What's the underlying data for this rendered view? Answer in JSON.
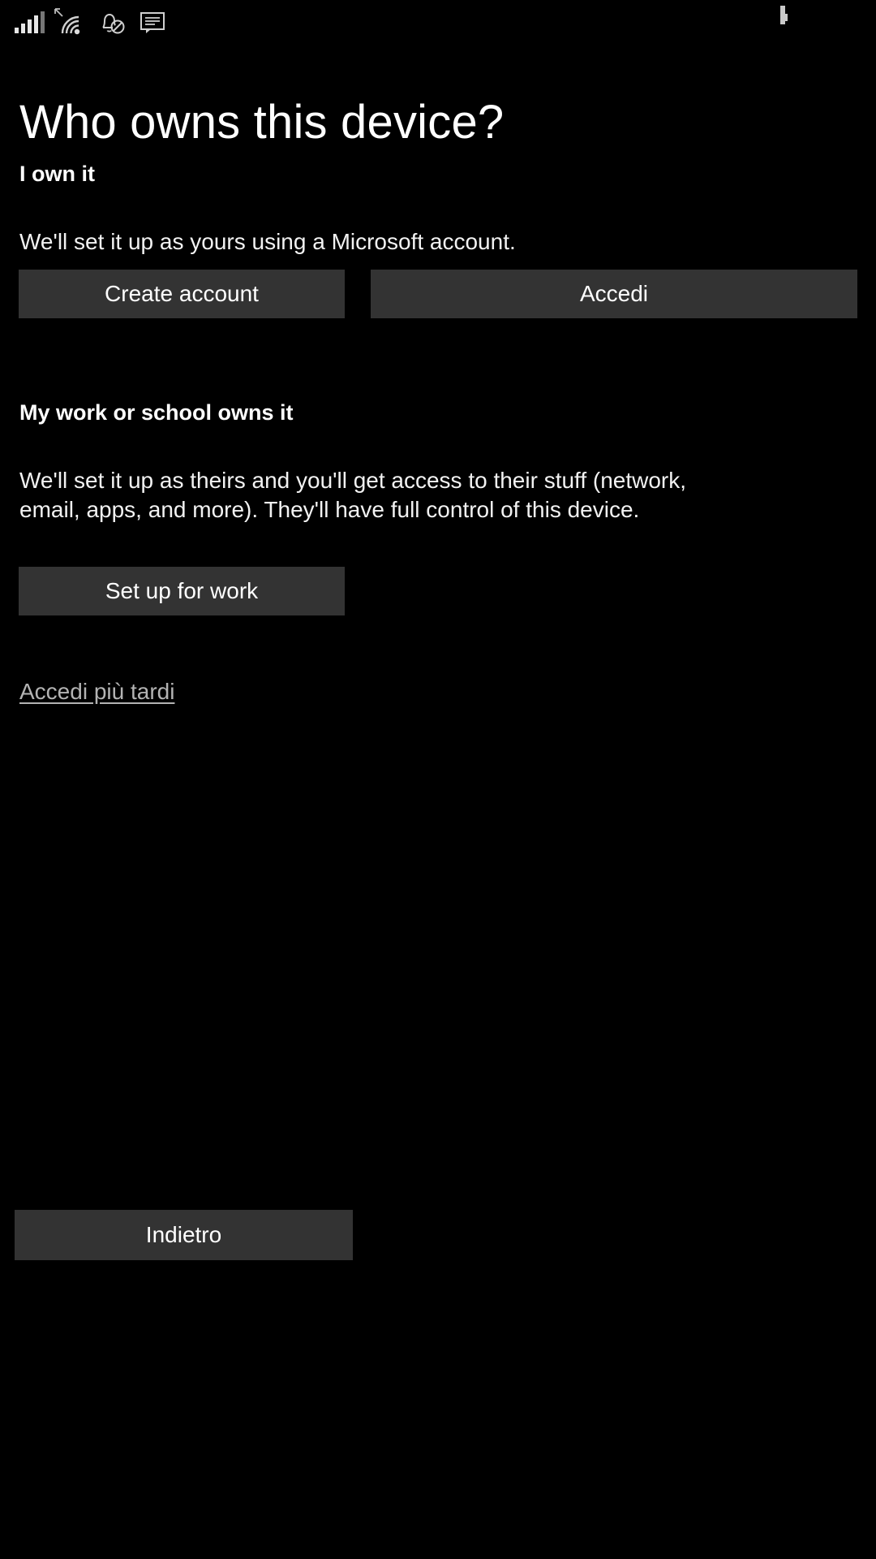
{
  "status_bar": {
    "icons": [
      {
        "name": "cellular-signal-icon",
        "bars": 5,
        "active_bars": 4
      },
      {
        "name": "wifi-icon",
        "label": "wifi"
      },
      {
        "name": "data-transfer-arrow-icon",
        "label": "data activity"
      },
      {
        "name": "notifications-off-icon",
        "label": "quiet hours"
      },
      {
        "name": "sms-message-icon",
        "label": "messaging"
      },
      {
        "name": "battery-icon",
        "label": "battery full"
      }
    ]
  },
  "page": {
    "title": "Who owns this device?"
  },
  "sections": [
    {
      "heading": "I own it",
      "description": "We'll set it up as yours using a Microsoft account.",
      "buttons": [
        {
          "label": "Create account",
          "name": "create-account-button"
        },
        {
          "label": "Accedi",
          "name": "sign-in-button"
        }
      ]
    },
    {
      "heading": "My work or school owns it",
      "description": "We'll set it up as theirs and you'll get access to their stuff (network, email, apps, and more). They'll have full control of this device.",
      "buttons": [
        {
          "label": "Set up for work",
          "name": "set-up-for-work-button"
        }
      ]
    }
  ],
  "link": {
    "label": "Accedi più tardi"
  },
  "footer": {
    "back_label": "Indietro"
  },
  "colors": {
    "background": "#000000",
    "button_fill": "#333333",
    "text": "#ffffff",
    "link_text": "#b3b3b3",
    "icon": "#e6e6e6"
  }
}
